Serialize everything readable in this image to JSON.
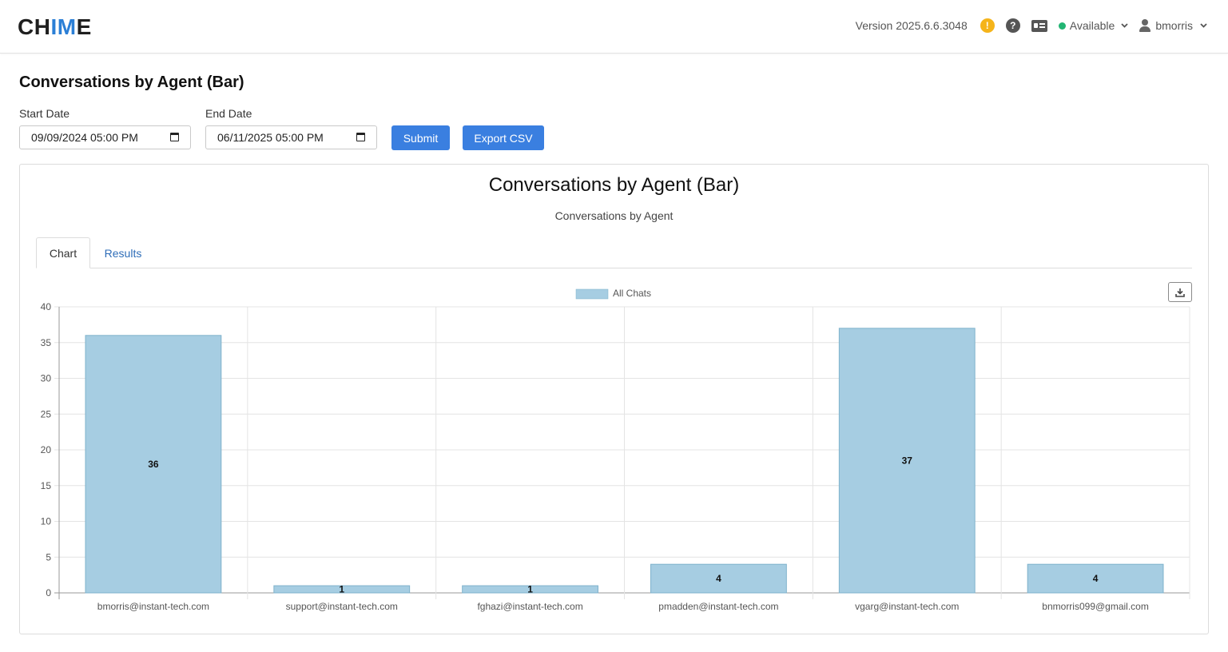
{
  "header": {
    "logo_a": "CH",
    "logo_b": "IM",
    "logo_c": "E",
    "version": "Version 2025.6.6.3048",
    "warn_glyph": "!",
    "help_glyph": "?",
    "status": "Available",
    "username": "bmorris"
  },
  "page": {
    "title": "Conversations by Agent (Bar)",
    "start_label": "Start Date",
    "start_value": "09/09/2024 05:00  PM",
    "end_label": "End Date",
    "end_value": "06/11/2025 05:00  PM",
    "submit_label": "Submit",
    "export_label": "Export CSV"
  },
  "report": {
    "title": "Conversations by Agent (Bar)",
    "subtitle": "Conversations by Agent",
    "tabs": [
      {
        "label": "Chart",
        "active": true
      },
      {
        "label": "Results",
        "active": false
      }
    ]
  },
  "icons": {
    "warn": "alert-icon",
    "help": "help-icon",
    "card": "contact-card-icon",
    "user": "user-icon",
    "download": "download-icon",
    "calendar": "calendar-icon"
  },
  "colors": {
    "accent": "#3a7fe0",
    "bar_fill": "#a6cde2",
    "bar_stroke": "#7fb2cc",
    "status_green": "#22b573",
    "warn": "#f5b41a"
  },
  "chart_data": {
    "type": "bar",
    "categories": [
      "bmorris@instant-tech.com",
      "support@instant-tech.com",
      "fghazi@instant-tech.com",
      "pmadden@instant-tech.com",
      "vgarg@instant-tech.com",
      "bnmorris099@gmail.com"
    ],
    "series": [
      {
        "name": "All Chats",
        "values": [
          36,
          1,
          1,
          4,
          37,
          4
        ]
      }
    ],
    "ylim": [
      0,
      40
    ],
    "yticks": [
      0,
      5,
      10,
      15,
      20,
      25,
      30,
      35,
      40
    ],
    "xlabel": "",
    "ylabel": "",
    "grid": true,
    "legend": "top-center",
    "data_labels": true
  }
}
